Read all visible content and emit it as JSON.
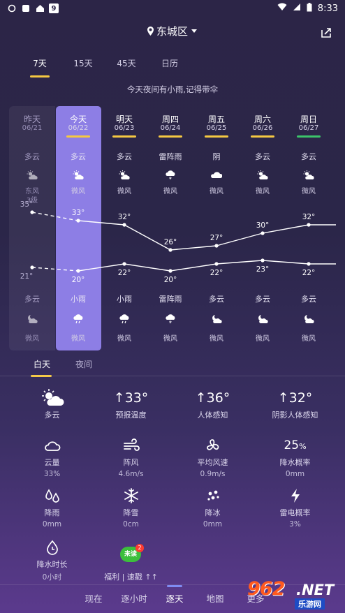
{
  "status_bar": {
    "time": "8:33",
    "notify_badge": "9"
  },
  "header": {
    "location": "东城区"
  },
  "tabs": [
    "7天",
    "15天",
    "45天",
    "日历"
  ],
  "tip": "今天夜间有小雨,记得带伞",
  "days": [
    {
      "day": "昨天",
      "date": "06/21",
      "day_weather": "多云",
      "day_wind": "东风",
      "day_wind_level": "3级",
      "high": "35°",
      "low": "21°",
      "night_weather": "多云",
      "night_wind": "微风",
      "bar": ""
    },
    {
      "day": "今天",
      "date": "06/22",
      "day_weather": "多云",
      "day_wind": "微风",
      "day_wind_level": "",
      "high": "33°",
      "low": "20°",
      "night_weather": "小雨",
      "night_wind": "微风",
      "bar": "#f5c842"
    },
    {
      "day": "明天",
      "date": "06/23",
      "day_weather": "多云",
      "day_wind": "微风",
      "day_wind_level": "",
      "high": "32°",
      "low": "22°",
      "night_weather": "小雨",
      "night_wind": "微风",
      "bar": "#f5c842"
    },
    {
      "day": "周四",
      "date": "06/24",
      "day_weather": "雷阵雨",
      "day_wind": "微风",
      "day_wind_level": "",
      "high": "26°",
      "low": "20°",
      "night_weather": "雷阵雨",
      "night_wind": "微风",
      "bar": "#f5c842"
    },
    {
      "day": "周五",
      "date": "06/25",
      "day_weather": "阴",
      "day_wind": "微风",
      "day_wind_level": "",
      "high": "27°",
      "low": "22°",
      "night_weather": "多云",
      "night_wind": "微风",
      "bar": "#f5c842"
    },
    {
      "day": "周六",
      "date": "06/26",
      "day_weather": "多云",
      "day_wind": "微风",
      "day_wind_level": "",
      "high": "30°",
      "low": "23°",
      "night_weather": "多云",
      "night_wind": "微风",
      "bar": "#f5c842"
    },
    {
      "day": "周日",
      "date": "06/27",
      "day_weather": "多云",
      "day_wind": "微风",
      "day_wind_level": "",
      "high": "32°",
      "low": "22°",
      "night_weather": "多云",
      "night_wind": "微风",
      "bar": "#3cc46a"
    }
  ],
  "highs": [
    35,
    33,
    32,
    26,
    27,
    30,
    32
  ],
  "lows": [
    21,
    20,
    22,
    20,
    22,
    23,
    22
  ],
  "day_night_tabs": [
    "白天",
    "夜间"
  ],
  "details": {
    "weather": "多云",
    "forecast_temp": {
      "value": "↑33°",
      "label": "预报温度"
    },
    "feel_temp": {
      "value": "↑36°",
      "label": "人体感知"
    },
    "shade_feel": {
      "value": "↑32°",
      "label": "阴影人体感知"
    },
    "cloud": {
      "label": "云量",
      "value": "33%"
    },
    "gust": {
      "label": "阵风",
      "value": "4.6m/s"
    },
    "avg_wind": {
      "label": "平均风速",
      "value": "0.9m/s"
    },
    "rain_prob": {
      "big": "25",
      "unit": "%",
      "label": "降水概率",
      "value": "0mm"
    },
    "rain": {
      "label": "降雨",
      "value": "0mm"
    },
    "snow": {
      "label": "降雪",
      "value": "0cm"
    },
    "ice": {
      "label": "降冰",
      "value": "0mm"
    },
    "thunder": {
      "label": "雷电概率",
      "value": "3%"
    },
    "precip_time": {
      "label": "降水时长",
      "value": "0小时"
    },
    "promo": {
      "label": "福利 | 速戳 ↑↑",
      "badge": "2",
      "bubble": "来读"
    }
  },
  "bottom_nav": [
    "现在",
    "逐小时",
    "逐天",
    "地图",
    "更多"
  ],
  "brand": {
    "num": "962",
    "net": ".NET",
    "sub": "乐游网"
  }
}
